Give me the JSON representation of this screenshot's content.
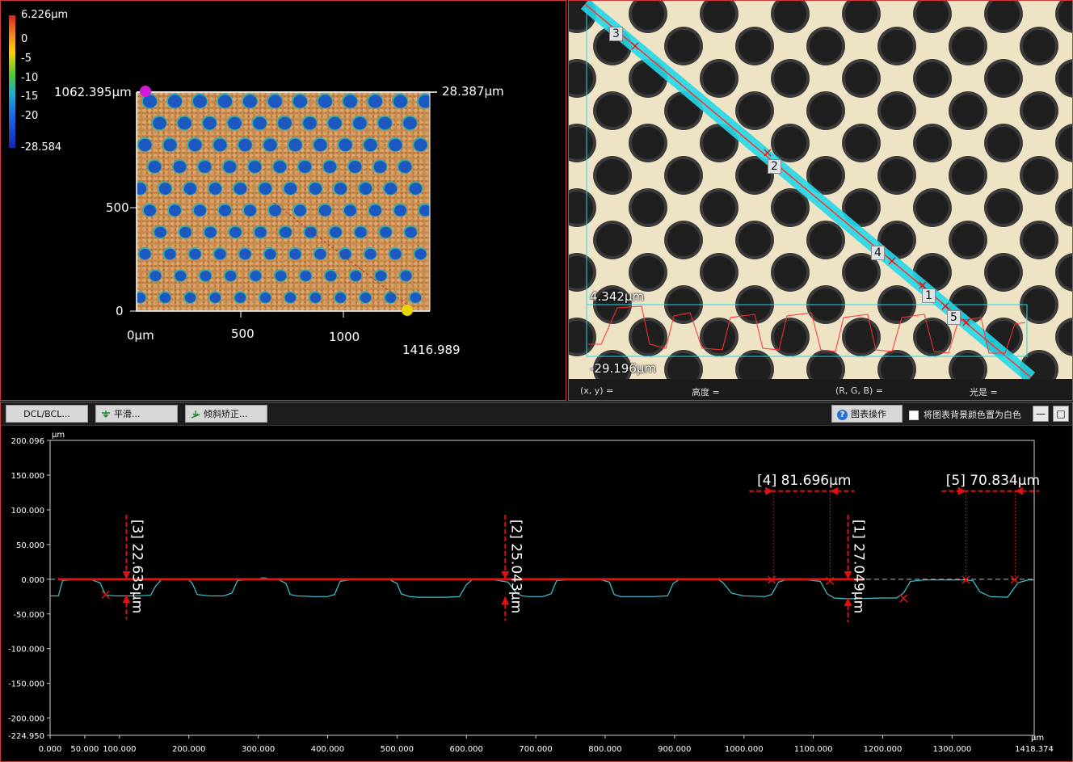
{
  "view3d": {
    "colorbar": {
      "labels": [
        "6.226µm",
        "0",
        "-5",
        "-10",
        "-15",
        "-20",
        "-28.584"
      ]
    },
    "labels": {
      "y_max": "1062.395µm",
      "z_right": "28.387µm",
      "y_500": "500",
      "y_0": "0",
      "x_0": "0µm",
      "x_500": "500",
      "x_1000": "1000",
      "x_max": "1416.989"
    },
    "marker_colors": {
      "start": "#d41ad4",
      "end": "#e8d400"
    }
  },
  "optical": {
    "labels": {
      "z_top": "4.342µm",
      "z_bottom": "-29.196µm"
    },
    "line_markers": [
      "3",
      "2",
      "4",
      "1",
      "5"
    ],
    "status": {
      "xy": "(x, y)  =",
      "height": "高度  =",
      "rgb": "(R, G, B)  =",
      "brightness": "光是  ="
    }
  },
  "toolbar": {
    "dcl_label": "DCL/BCL...",
    "smooth_label": "平滑...",
    "tilt_label": "倾斜矫正...",
    "chart_ops_label": "图表操作",
    "white_bg_label": "将图表背景颜色置为白色",
    "minimize_label": "—",
    "maximize_label": "□"
  },
  "chart_data": {
    "type": "line",
    "ylabel": "µm",
    "xlabel": "µm",
    "xlim": [
      0.0,
      1418.374
    ],
    "ylim": [
      -224.95,
      200.096
    ],
    "y_ticks": [
      "200.096",
      "150.000",
      "100.000",
      "50.000",
      "0.000",
      "-50.000",
      "-100.000",
      "-150.000",
      "-200.000",
      "-224.950"
    ],
    "y_tick_values": [
      200.096,
      150,
      100,
      50,
      0,
      -50,
      -100,
      -150,
      -200,
      -224.95
    ],
    "x_ticks": [
      "0.000",
      "50.000",
      "100.000",
      "200.000",
      "300.000",
      "400.000",
      "500.000",
      "600.000",
      "700.000",
      "800.000",
      "900.000",
      "1000.000",
      "1100.000",
      "1200.000",
      "1300.000",
      "1418.374"
    ],
    "x_tick_values": [
      0,
      50,
      100,
      200,
      300,
      400,
      500,
      600,
      700,
      800,
      900,
      1000,
      1100,
      1200,
      1300,
      1418.374
    ],
    "profile": {
      "color": "#3fc8cf",
      "x": [
        0,
        12,
        18,
        40,
        60,
        72,
        80,
        95,
        120,
        145,
        152,
        160,
        180,
        200,
        205,
        212,
        230,
        250,
        262,
        270,
        290,
        300,
        305,
        310,
        318,
        330,
        340,
        346,
        356,
        380,
        400,
        410,
        418,
        432,
        450,
        470,
        490,
        500,
        506,
        518,
        530,
        550,
        570,
        590,
        600,
        608,
        622,
        640,
        660,
        672,
        680,
        690,
        710,
        722,
        730,
        746,
        770,
        790,
        806,
        813,
        822,
        840,
        870,
        890,
        898,
        906,
        930,
        950,
        962,
        970,
        982,
        1000,
        1030,
        1040,
        1050,
        1060,
        1090,
        1110,
        1120,
        1130,
        1145,
        1160,
        1200,
        1220,
        1230,
        1240,
        1260,
        1290,
        1320,
        1330,
        1340,
        1355,
        1380,
        1395,
        1410,
        1418
      ],
      "y": [
        -24,
        -24,
        -2,
        0,
        -1,
        -5,
        -23,
        -24,
        -24,
        -23,
        -10,
        -1,
        0,
        -1,
        -6,
        -22,
        -24,
        -24,
        -20,
        -2,
        0,
        0,
        2,
        2,
        0,
        -1,
        -6,
        -22,
        -24,
        -25,
        -25,
        -22,
        -3,
        -1,
        0,
        0,
        -1,
        -6,
        -21,
        -25,
        -26,
        -26,
        -26,
        -25,
        -8,
        -1,
        0,
        -1,
        -4,
        -20,
        -24,
        -25,
        -25,
        -21,
        -2,
        -1,
        0,
        0,
        -4,
        -22,
        -25,
        -25,
        -25,
        -24,
        -6,
        -1,
        0,
        0,
        0,
        -5,
        -20,
        -24,
        -25,
        -22,
        -4,
        -1,
        -1,
        -3,
        -21,
        -27,
        -28,
        -28,
        -27,
        -27,
        -20,
        -3,
        -1,
        -1,
        -1,
        -2,
        -18,
        -25,
        -26,
        -5,
        -1,
        -1
      ]
    },
    "zero_line_color": "#e01010",
    "x_markers": [
      {
        "x": 80,
        "y": -22
      },
      {
        "x": 1040,
        "y": 0
      },
      {
        "x": 1124,
        "y": -2
      },
      {
        "x": 1230,
        "y": -27
      },
      {
        "x": 1320,
        "y": 0
      },
      {
        "x": 1390,
        "y": 0
      }
    ],
    "annotations": [
      {
        "label": "[3] 22.635µm",
        "orientation": "vertical",
        "x": 110,
        "y_top": 0,
        "y_bottom": -22.635
      },
      {
        "label": "[2] 25.043µm",
        "orientation": "vertical",
        "x": 656,
        "y_top": 0,
        "y_bottom": -25.043
      },
      {
        "label": "[1] 27.049µm",
        "orientation": "vertical",
        "x": 1150,
        "y_top": 0,
        "y_bottom": -27.049
      },
      {
        "label": "[4] 81.696µm",
        "orientation": "horizontal",
        "x_start": 1042.5,
        "x_end": 1124.2,
        "y": 127
      },
      {
        "label": "[5] 70.834µm",
        "orientation": "horizontal",
        "x_start": 1320,
        "x_end": 1390.8,
        "y": 127
      }
    ]
  }
}
